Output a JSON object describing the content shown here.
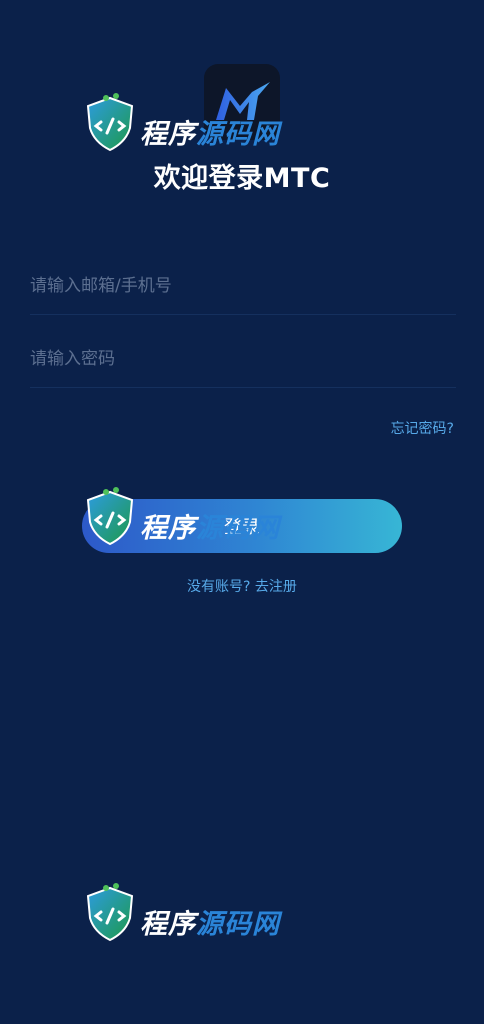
{
  "app": {
    "logo_icon": "mtc-logo-icon",
    "welcome_title": "欢迎登录MTC"
  },
  "form": {
    "account_placeholder": "请输入邮箱/手机号",
    "password_placeholder": "请输入密码",
    "account_value": "",
    "password_value": ""
  },
  "links": {
    "forgot_password": "忘记密码?",
    "register": "没有账号? 去注册"
  },
  "buttons": {
    "login": "登录"
  },
  "watermark": {
    "text_part1": "程序",
    "text_part2": "源码网"
  },
  "colors": {
    "background": "#0b214a",
    "accent_link": "#57a9e8",
    "button_gradient_start": "#2d59c9",
    "button_gradient_end": "#37b6d5"
  }
}
